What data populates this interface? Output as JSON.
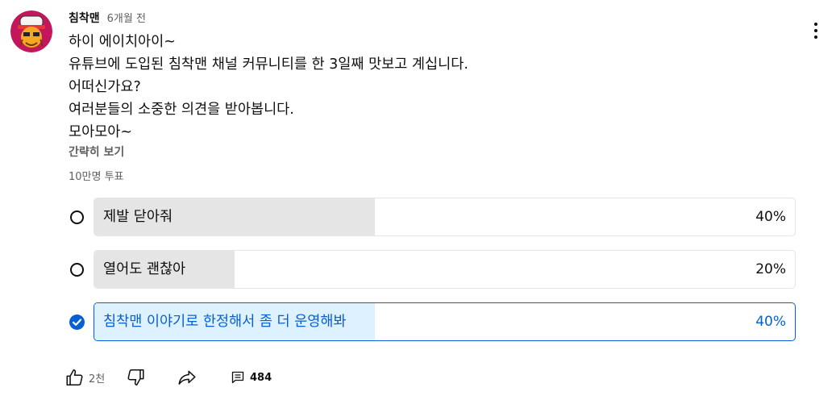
{
  "post": {
    "author": "침착맨",
    "time": "6개월 전",
    "lines": [
      "하이 에이치아이~",
      "유튜브에 도입된 침착맨 채널 커뮤니티를 한 3일째 맛보고 계십니다.",
      "어떠신가요?",
      "여러분들의 소중한 의견을 받아봅니다.",
      "모아모아~"
    ],
    "collapse_label": "간략히 보기"
  },
  "poll": {
    "vote_count": "10만명 투표",
    "options": [
      {
        "label": "제발 닫아줘",
        "percent": "40%",
        "value": 40,
        "selected": false
      },
      {
        "label": "열어도 괜찮아",
        "percent": "20%",
        "value": 20,
        "selected": false
      },
      {
        "label": "침착맨 이야기로 한정해서 좀 더 운영해봐",
        "percent": "40%",
        "value": 40,
        "selected": true
      }
    ]
  },
  "actions": {
    "like_count": "2천",
    "comment_count": "484"
  },
  "icons": {
    "avatar": "avatar-image",
    "menu": "more-vert-icon",
    "like": "thumbs-up-icon",
    "dislike": "thumbs-down-icon",
    "share": "share-arrow-icon",
    "comments": "comment-icon",
    "radio": "radio-unchecked-icon",
    "radio_checked": "check-circle-icon"
  },
  "colors": {
    "accent": "#065fd4",
    "selected_fill": "#def1ff",
    "bar_fill": "#e5e5e5",
    "secondary_text": "#606060"
  }
}
